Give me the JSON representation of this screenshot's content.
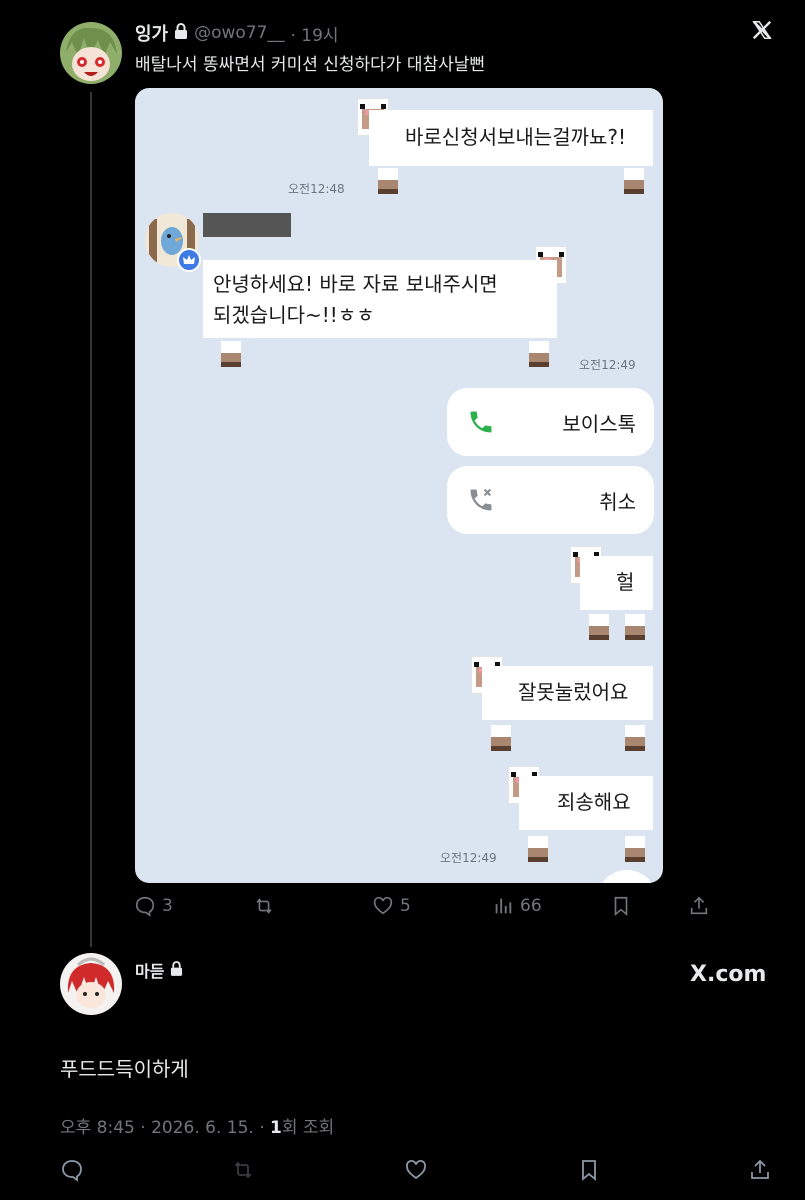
{
  "tweet": {
    "author_name": "잉가",
    "handle": "@owo77__",
    "time": "· 19시",
    "text": "배탈나서 똥싸면서 커미션 신청하다가 대참사날뻔",
    "stats": {
      "replies": "3",
      "likes": "5",
      "views": "66"
    }
  },
  "chat": {
    "msg1": "바로신청서보내는걸까뇨?!",
    "ts1": "오전12:48",
    "msg2_line1": "안녕하세요! 바로 자료 보내주시면",
    "msg2_line2": "되겠습니다~!!ㅎㅎ",
    "ts2": "오전12:49",
    "call1": "보이스톡",
    "call2": "취소",
    "msg3": "헐",
    "msg4": "잘못눌렀어요",
    "msg5": "죄송해요",
    "ts3": "오전12:49"
  },
  "quote": {
    "author_name": "마듣",
    "site": "X.com",
    "text": "푸드드득이하게",
    "meta_time": "오후 8:45 · 2026. 6. 15. · ",
    "meta_views_num": "1",
    "meta_views_label": "회 조회"
  },
  "icons": [
    "lock-icon",
    "x-logo-icon",
    "reply-icon",
    "retweet-icon",
    "like-icon",
    "views-icon",
    "bookmark-icon",
    "share-icon",
    "phone-icon",
    "phone-cancel-icon",
    "verified-crown-icon"
  ],
  "colors": {
    "background": "#000000",
    "text": "#e7e9ea",
    "muted": "#71767b",
    "chat_bg": "#dbe5f1",
    "call_green": "#2bb24c"
  }
}
